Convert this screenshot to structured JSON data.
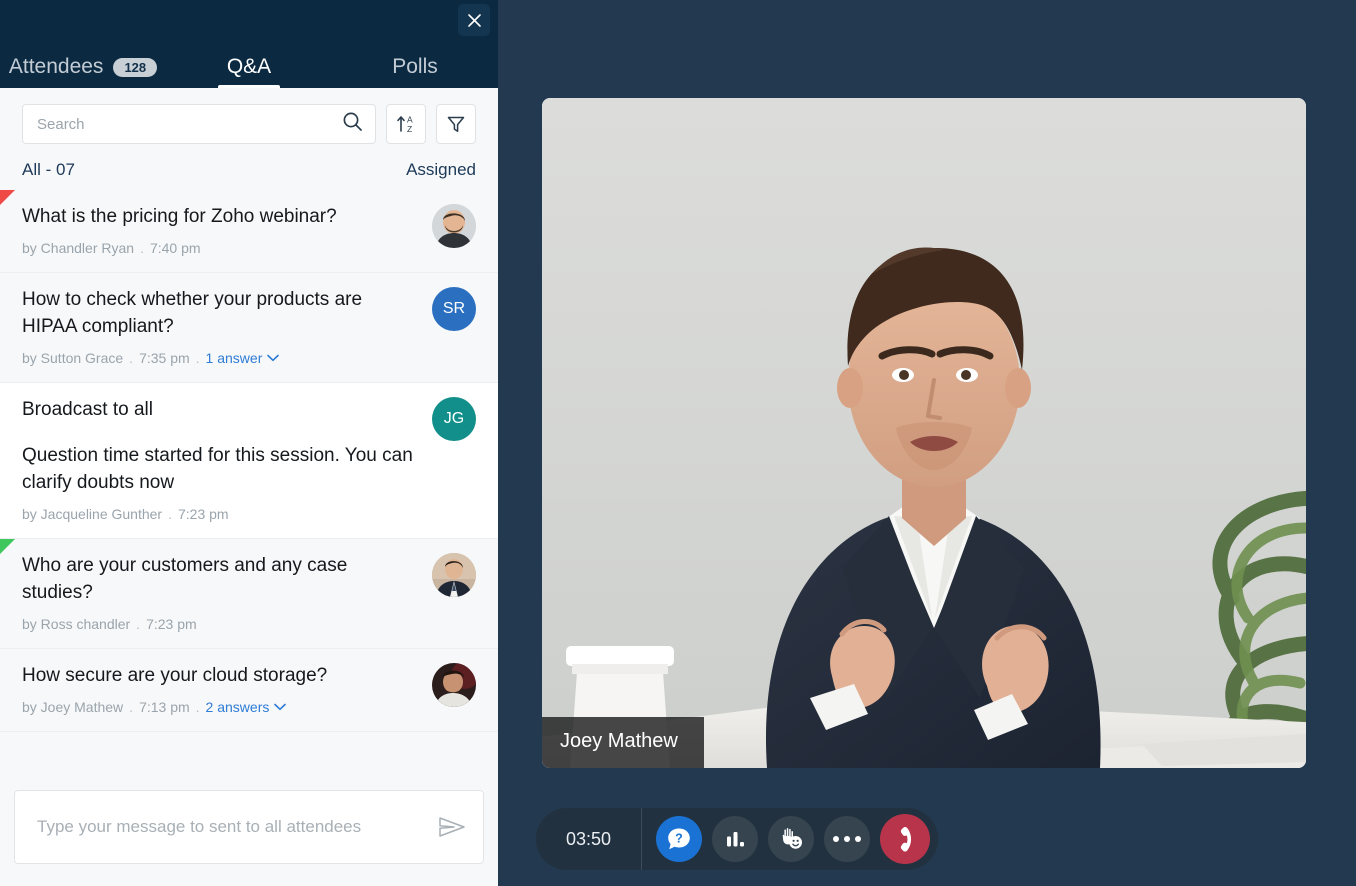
{
  "header": {
    "close_icon": "close-icon",
    "tabs": [
      {
        "label": "Attendees",
        "badge": "128",
        "active": false
      },
      {
        "label": "Q&A",
        "badge": "",
        "active": true
      },
      {
        "label": "Polls",
        "badge": "",
        "active": false
      }
    ]
  },
  "search": {
    "placeholder": "Search",
    "value": "",
    "search_icon": "search-icon",
    "sort_icon": "sort-az-icon",
    "filter_icon": "filter-icon"
  },
  "list_header": {
    "all_label": "All - 07",
    "assigned_label": "Assigned"
  },
  "questions": [
    {
      "flag": "#ef4a46",
      "title": "What is the pricing for Zoho webinar?",
      "subtitle": "",
      "author": "by Chandler Ryan",
      "time": "7:40 pm",
      "answers": "",
      "avatar_type": "photo",
      "avatar_initials": "",
      "avatar_color": "#cfd4d7",
      "background": "grey"
    },
    {
      "flag": "",
      "title": "How to check whether your products are HIPAA compliant?",
      "subtitle": "",
      "author": "by Sutton Grace",
      "time": "7:35 pm",
      "answers": "1 answer",
      "avatar_type": "initials",
      "avatar_initials": "SR",
      "avatar_color": "#2a6fc0",
      "background": "grey"
    },
    {
      "flag": "",
      "title": "Broadcast to all",
      "subtitle": "Question time started for this session. You can clarify doubts now",
      "author": "by Jacqueline Gunther",
      "time": "7:23 pm",
      "answers": "",
      "avatar_type": "initials",
      "avatar_initials": "JG",
      "avatar_color": "#128f8b",
      "background": "white"
    },
    {
      "flag": "#3fc65c",
      "title": "Who are your customers and any case studies?",
      "subtitle": "",
      "author": "by Ross chandler",
      "time": "7:23 pm",
      "answers": "",
      "avatar_type": "photo2",
      "avatar_initials": "",
      "avatar_color": "#cbb6a4",
      "background": "grey"
    },
    {
      "flag": "",
      "title": "How secure are your cloud storage?",
      "subtitle": "",
      "author": "by Joey Mathew",
      "time": "7:13 pm",
      "answers": "2 answers",
      "avatar_type": "photo3",
      "avatar_initials": "",
      "avatar_color": "#3a2a28",
      "background": "grey"
    }
  ],
  "composer": {
    "placeholder": "Type your message to sent to all attendees",
    "value": "",
    "send_icon": "send-icon"
  },
  "stage": {
    "presenter_name": "Joey Mathew",
    "timer": "03:50",
    "controls": [
      {
        "name": "qa-button",
        "icon": "question-bubble-icon",
        "style": "primary"
      },
      {
        "name": "polls-button",
        "icon": "bar-chart-icon",
        "style": "default"
      },
      {
        "name": "reactions-button",
        "icon": "raise-hand-emoji-icon",
        "style": "default"
      },
      {
        "name": "more-options-button",
        "icon": "ellipsis-icon",
        "style": "default"
      },
      {
        "name": "end-call-button",
        "icon": "phone-hangup-icon",
        "style": "danger"
      }
    ]
  },
  "colors": {
    "header_bg": "#0b2a42",
    "stage_bg": "#23394f",
    "panel_bg": "#f7f8f9",
    "accent_blue": "#2e7cd6",
    "primary_button": "#1a73d4",
    "danger": "#b8344a",
    "flag_red": "#ef4a46",
    "flag_green": "#3fc65c"
  }
}
